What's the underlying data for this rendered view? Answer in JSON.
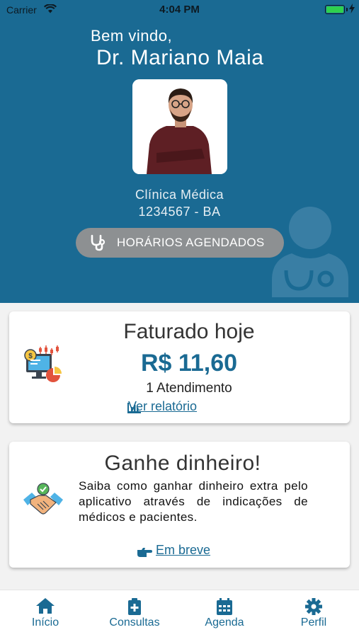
{
  "status_bar": {
    "carrier": "Carrier",
    "time": "4:04 PM"
  },
  "header": {
    "welcome": "Bem vindo,",
    "doctor_name": "Dr. Mariano Maia",
    "specialty": "Clínica Médica",
    "crm": "1234567 - BA",
    "schedule_button": "HORÁRIOS AGENDADOS"
  },
  "billing_card": {
    "title": "Faturado hoje",
    "amount": "R$ 11,60",
    "appointments": "1 Atendimento",
    "report_link": "Ver relatório"
  },
  "earn_card": {
    "title": "Ganhe dinheiro!",
    "description": "Saiba como ganhar dinheiro extra pelo aplicativo através de indicações de médicos e pacientes.",
    "soon_link": "Em breve"
  },
  "tabbar": {
    "items": [
      {
        "label": "Início",
        "icon": "home-icon"
      },
      {
        "label": "Consultas",
        "icon": "clipboard-plus-icon"
      },
      {
        "label": "Agenda",
        "icon": "calendar-icon"
      },
      {
        "label": "Perfil",
        "icon": "gear-icon"
      }
    ]
  },
  "colors": {
    "primary": "#1a6a93",
    "header_bg": "#1a6a93",
    "button_gray": "#8d9092"
  }
}
